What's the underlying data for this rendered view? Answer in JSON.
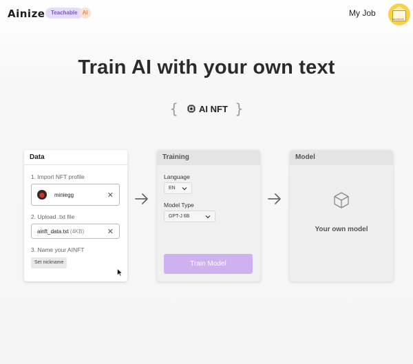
{
  "header": {
    "logo": "Ainize",
    "badge_teachable": "Teachable",
    "badge_ai": "AI",
    "my_job": "My Job",
    "avatar_icon": "profile-avatar",
    "avatar_label": "ainetwork"
  },
  "hero": {
    "title": "Train AI with your own text",
    "subtitle": "AI NFT",
    "subtitle_icon": "chip-icon"
  },
  "data_card": {
    "title": "Data",
    "step1_label": "1. Import NFT profile",
    "nft_name": "miniegg",
    "step2_label": "2. Upload .txt file",
    "file_name": "ainft_data.txt",
    "file_size": "(4KB)",
    "step3_label": "3. Name your AINFT",
    "nickname_button": "Set nickname"
  },
  "training_card": {
    "title": "Training",
    "language_label": "Language",
    "language_value": "EN",
    "model_type_label": "Model Type",
    "model_type_value": "GPT-J 6B",
    "train_button": "Train Model"
  },
  "model_card": {
    "title": "Model",
    "model_icon": "cube-icon",
    "text": "Your own model"
  },
  "colors": {
    "accent_purple": "#cdb2ef",
    "badge_purple": "#e5dcf8",
    "badge_orange": "#fbe1cf"
  }
}
